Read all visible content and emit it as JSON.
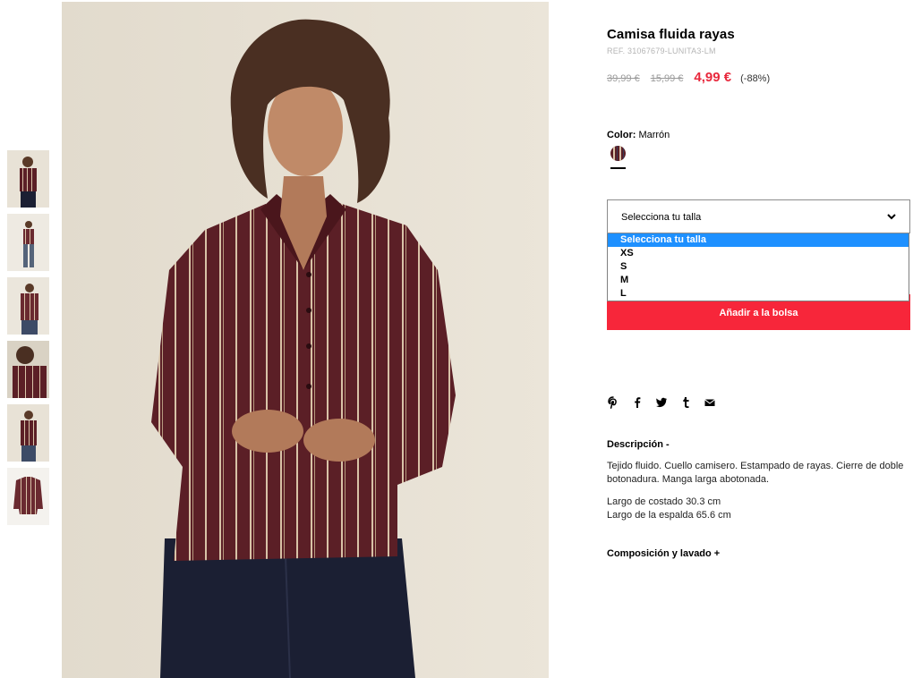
{
  "product": {
    "title": "Camisa fluida rayas",
    "ref": "REF. 31067679-LUNITA3-LM",
    "old_price_1": "39,99 €",
    "old_price_2": "15,99 €",
    "price": "4,99 €",
    "discount": "(-88%)"
  },
  "color": {
    "label": "Color:",
    "value": "Marrón",
    "swatch": "burgundy-stripes"
  },
  "size_select": {
    "value": "Selecciona tu talla",
    "options": [
      "Selecciona tu talla",
      "XS",
      "S",
      "M",
      "L"
    ],
    "selected_option": "Selecciona tu talla"
  },
  "add_to_bag_label": "Añadir a la bolsa",
  "social": [
    "pinterest-icon",
    "facebook-icon",
    "twitter-icon",
    "tumblr-icon",
    "email-icon"
  ],
  "description": {
    "title": "Descripción  -",
    "text": "Tejido fluido. Cuello camisero. Estampado de rayas. Cierre de doble botonadura. Manga larga abotonada.",
    "measure_1": "Largo de costado 30.3 cm",
    "measure_2": "Largo de la espalda 65.6 cm"
  },
  "composition_title": "Composición y lavado  +",
  "colors": {
    "accent_red": "#f7263a",
    "price_red": "#e8283c",
    "selected_option_blue": "#1e90ff",
    "shirt_burgundy": "#5b1f26",
    "pants_navy": "#1b1f33"
  },
  "thumbnail_count": 6
}
